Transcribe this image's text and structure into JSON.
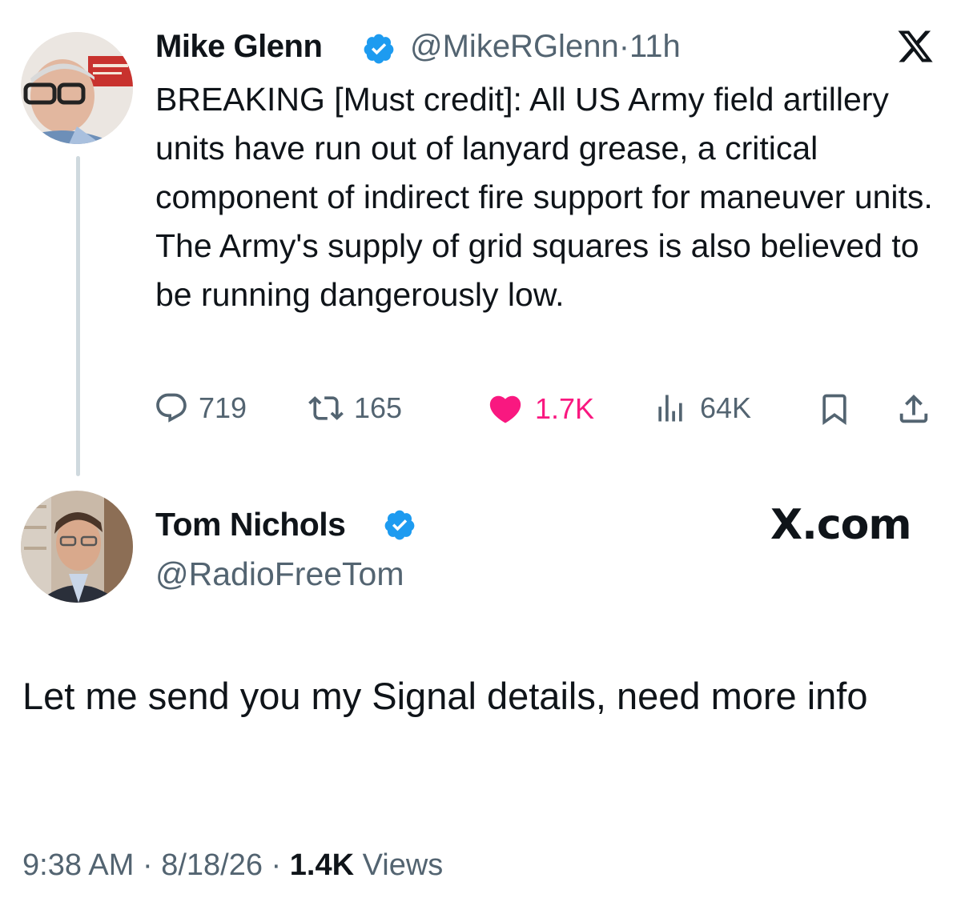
{
  "quoted_tweet": {
    "author_name": "Mike Glenn",
    "handle": "@MikeRGlenn",
    "separator": "·",
    "time": "11h",
    "platform_icon": "x-logo-icon",
    "text": "BREAKING [Must credit]: All US Army field artillery units have run out of lanyard grease, a critical component of indirect fire support for maneuver units. The Army's supply of grid squares is also believed to be running dangerously low.",
    "actions": {
      "replies": "719",
      "reposts": "165",
      "likes": "1.7K",
      "views": "64K"
    },
    "like_color": "#f91880"
  },
  "reply_tweet": {
    "author_name": "Tom Nichols",
    "handle": "@RadioFreeTom",
    "platform_label": "X.com",
    "text": "Let me send you my Signal details, need more info",
    "timestamp": "9:38 AM · 8/18/26 ·",
    "views_count": "1.4K",
    "views_label": "Views"
  },
  "colors": {
    "verified": "#1d9bf0",
    "secondary_text": "#536471",
    "thread_line": "#cfd9de"
  }
}
